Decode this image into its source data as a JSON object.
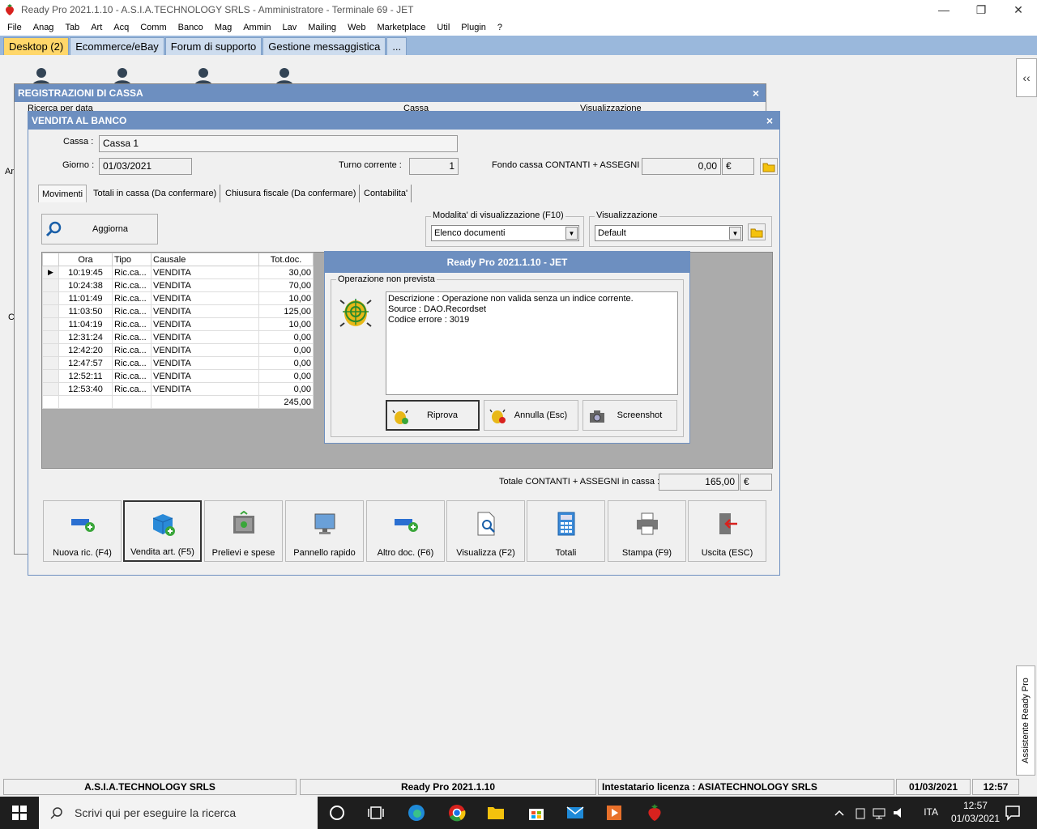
{
  "window": {
    "title": "Ready Pro 2021.1.10 - A.S.I.A.TECHNOLOGY SRLS - Amministratore - Terminale 69 - JET"
  },
  "menu": [
    "File",
    "Anag",
    "Tab",
    "Art",
    "Acq",
    "Comm",
    "Banco",
    "Mag",
    "Ammin",
    "Lav",
    "Mailing",
    "Web",
    "Marketplace",
    "Util",
    "Plugin",
    "?"
  ],
  "tabs": [
    "Desktop (2)",
    "Ecommerce/eBay",
    "Forum di supporto",
    "Gestione messaggistica",
    "..."
  ],
  "side": {
    "collapse": "‹‹",
    "assistant": "Assistente Ready Pro"
  },
  "registrazioni": {
    "title": "REGISTRAZIONI DI CASSA",
    "labels": [
      "Ricerca per data",
      "Cassa",
      "Visualizzazione"
    ],
    "left_fragments": [
      "Ar",
      "C"
    ]
  },
  "vendita": {
    "title": "VENDITA AL BANCO",
    "cassa_label": "Cassa :",
    "cassa_value": "Cassa 1",
    "giorno_label": "Giorno :",
    "giorno_value": "01/03/2021",
    "turno_label": "Turno corrente :",
    "turno_value": "1",
    "fondo_label": "Fondo cassa CONTANTI + ASSEGNI :",
    "fondo_value": "0,00",
    "fondo_currency": "€",
    "tabs": [
      "Movimenti",
      "Totali in cassa (Da confermare)",
      "Chiusura fiscale (Da confermare)",
      "Contabilita'"
    ],
    "aggiorna": "Aggiorna",
    "modalita_title": "Modalita' di visualizzazione (F10)",
    "modalita_value": "Elenco documenti",
    "visual_title": "Visualizzazione",
    "visual_value": "Default",
    "grid": {
      "columns": [
        "Ora",
        "Tipo",
        "Causale",
        "Tot.doc."
      ],
      "rows": [
        {
          "ora": "10:19:45",
          "tipo": "Ric.ca...",
          "causale": "VENDITA",
          "tot": "30,00"
        },
        {
          "ora": "10:24:38",
          "tipo": "Ric.ca...",
          "causale": "VENDITA",
          "tot": "70,00"
        },
        {
          "ora": "11:01:49",
          "tipo": "Ric.ca...",
          "causale": "VENDITA",
          "tot": "10,00"
        },
        {
          "ora": "11:03:50",
          "tipo": "Ric.ca...",
          "causale": "VENDITA",
          "tot": "125,00"
        },
        {
          "ora": "11:04:19",
          "tipo": "Ric.ca...",
          "causale": "VENDITA",
          "tot": "10,00"
        },
        {
          "ora": "12:31:24",
          "tipo": "Ric.ca...",
          "causale": "VENDITA",
          "tot": "0,00"
        },
        {
          "ora": "12:42:20",
          "tipo": "Ric.ca...",
          "causale": "VENDITA",
          "tot": "0,00"
        },
        {
          "ora": "12:47:57",
          "tipo": "Ric.ca...",
          "causale": "VENDITA",
          "tot": "0,00"
        },
        {
          "ora": "12:52:11",
          "tipo": "Ric.ca...",
          "causale": "VENDITA",
          "tot": "0,00"
        },
        {
          "ora": "12:53:40",
          "tipo": "Ric.ca...",
          "causale": "VENDITA",
          "tot": "0,00"
        }
      ],
      "total": "245,00"
    },
    "totale_label": "Totale CONTANTI + ASSEGNI in cassa :",
    "totale_value": "165,00",
    "totale_currency": "€",
    "buttons": [
      "Nuova ric. (F4)",
      "Vendita art. (F5)",
      "Prelievi e spese",
      "Pannello rapido",
      "Altro doc. (F6)",
      "Visualizza (F2)",
      "Totali",
      "Stampa (F9)",
      "Uscita (ESC)"
    ]
  },
  "dialog": {
    "title": "Ready Pro 2021.1.10 - JET",
    "group": "Operazione non prevista",
    "lines": [
      "Descrizione : Operazione non valida senza un indice corrente.",
      "Source : DAO.Recordset",
      "Codice errore : 3019"
    ],
    "buttons": [
      "Riprova",
      "Annulla (Esc)",
      "Screenshot"
    ]
  },
  "status": {
    "company": "A.S.I.A.TECHNOLOGY SRLS",
    "version": "Ready Pro 2021.1.10",
    "license": "Intestatario licenza : ASIATECHNOLOGY SRLS",
    "date": "01/03/2021",
    "time": "12:57"
  },
  "taskbar": {
    "search_placeholder": "Scrivi qui per eseguire la ricerca",
    "lang": "ITA",
    "time": "12:57",
    "date": "01/03/2021"
  }
}
